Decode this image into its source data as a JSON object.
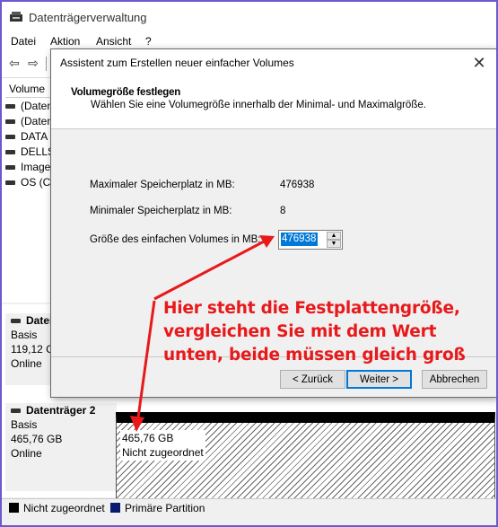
{
  "window": {
    "title": "Datenträgerverwaltung",
    "menu": [
      "Datei",
      "Aktion",
      "Ansicht",
      "?"
    ]
  },
  "volume_list": {
    "column_header": "Volume",
    "rows": [
      "(Daten",
      "(Daten",
      "DATA",
      "DELLS",
      "Image",
      "OS (C"
    ]
  },
  "disks": [
    {
      "name": "Daten",
      "type": "Basis",
      "size": "119,12 G",
      "status": "Online"
    },
    {
      "name": "Datenträger 2",
      "type": "Basis",
      "size": "465,76 GB",
      "status": "Online",
      "partition": {
        "size": "465,76 GB",
        "state": "Nicht zugeordnet"
      }
    }
  ],
  "legend": [
    {
      "label": "Nicht zugeordnet",
      "color": "#000000"
    },
    {
      "label": "Primäre Partition",
      "color": "#0a1a6e"
    }
  ],
  "wizard": {
    "title": "Assistent zum Erstellen neuer einfacher Volumes",
    "close_glyph": "✕",
    "header_title": "Volumegröße festlegen",
    "header_subtitle": "Wählen Sie eine Volumegröße innerhalb der Minimal- und Maximalgröße.",
    "max_label": "Maximaler Speicherplatz in MB:",
    "max_value": "476938",
    "min_label": "Minimaler Speicherplatz in MB:",
    "min_value": "8",
    "size_label": "Größe des einfachen Volumes in MB:",
    "size_value": "476938",
    "back_button": "< Zurück",
    "next_button": "Weiter >",
    "cancel_button": "Abbrechen"
  },
  "annotation": {
    "lines": [
      "Hier steht die Festplattengröße,",
      "vergleichen Sie mit dem Wert",
      "unten, beide müssen gleich groß"
    ],
    "color": "#e8191b"
  }
}
